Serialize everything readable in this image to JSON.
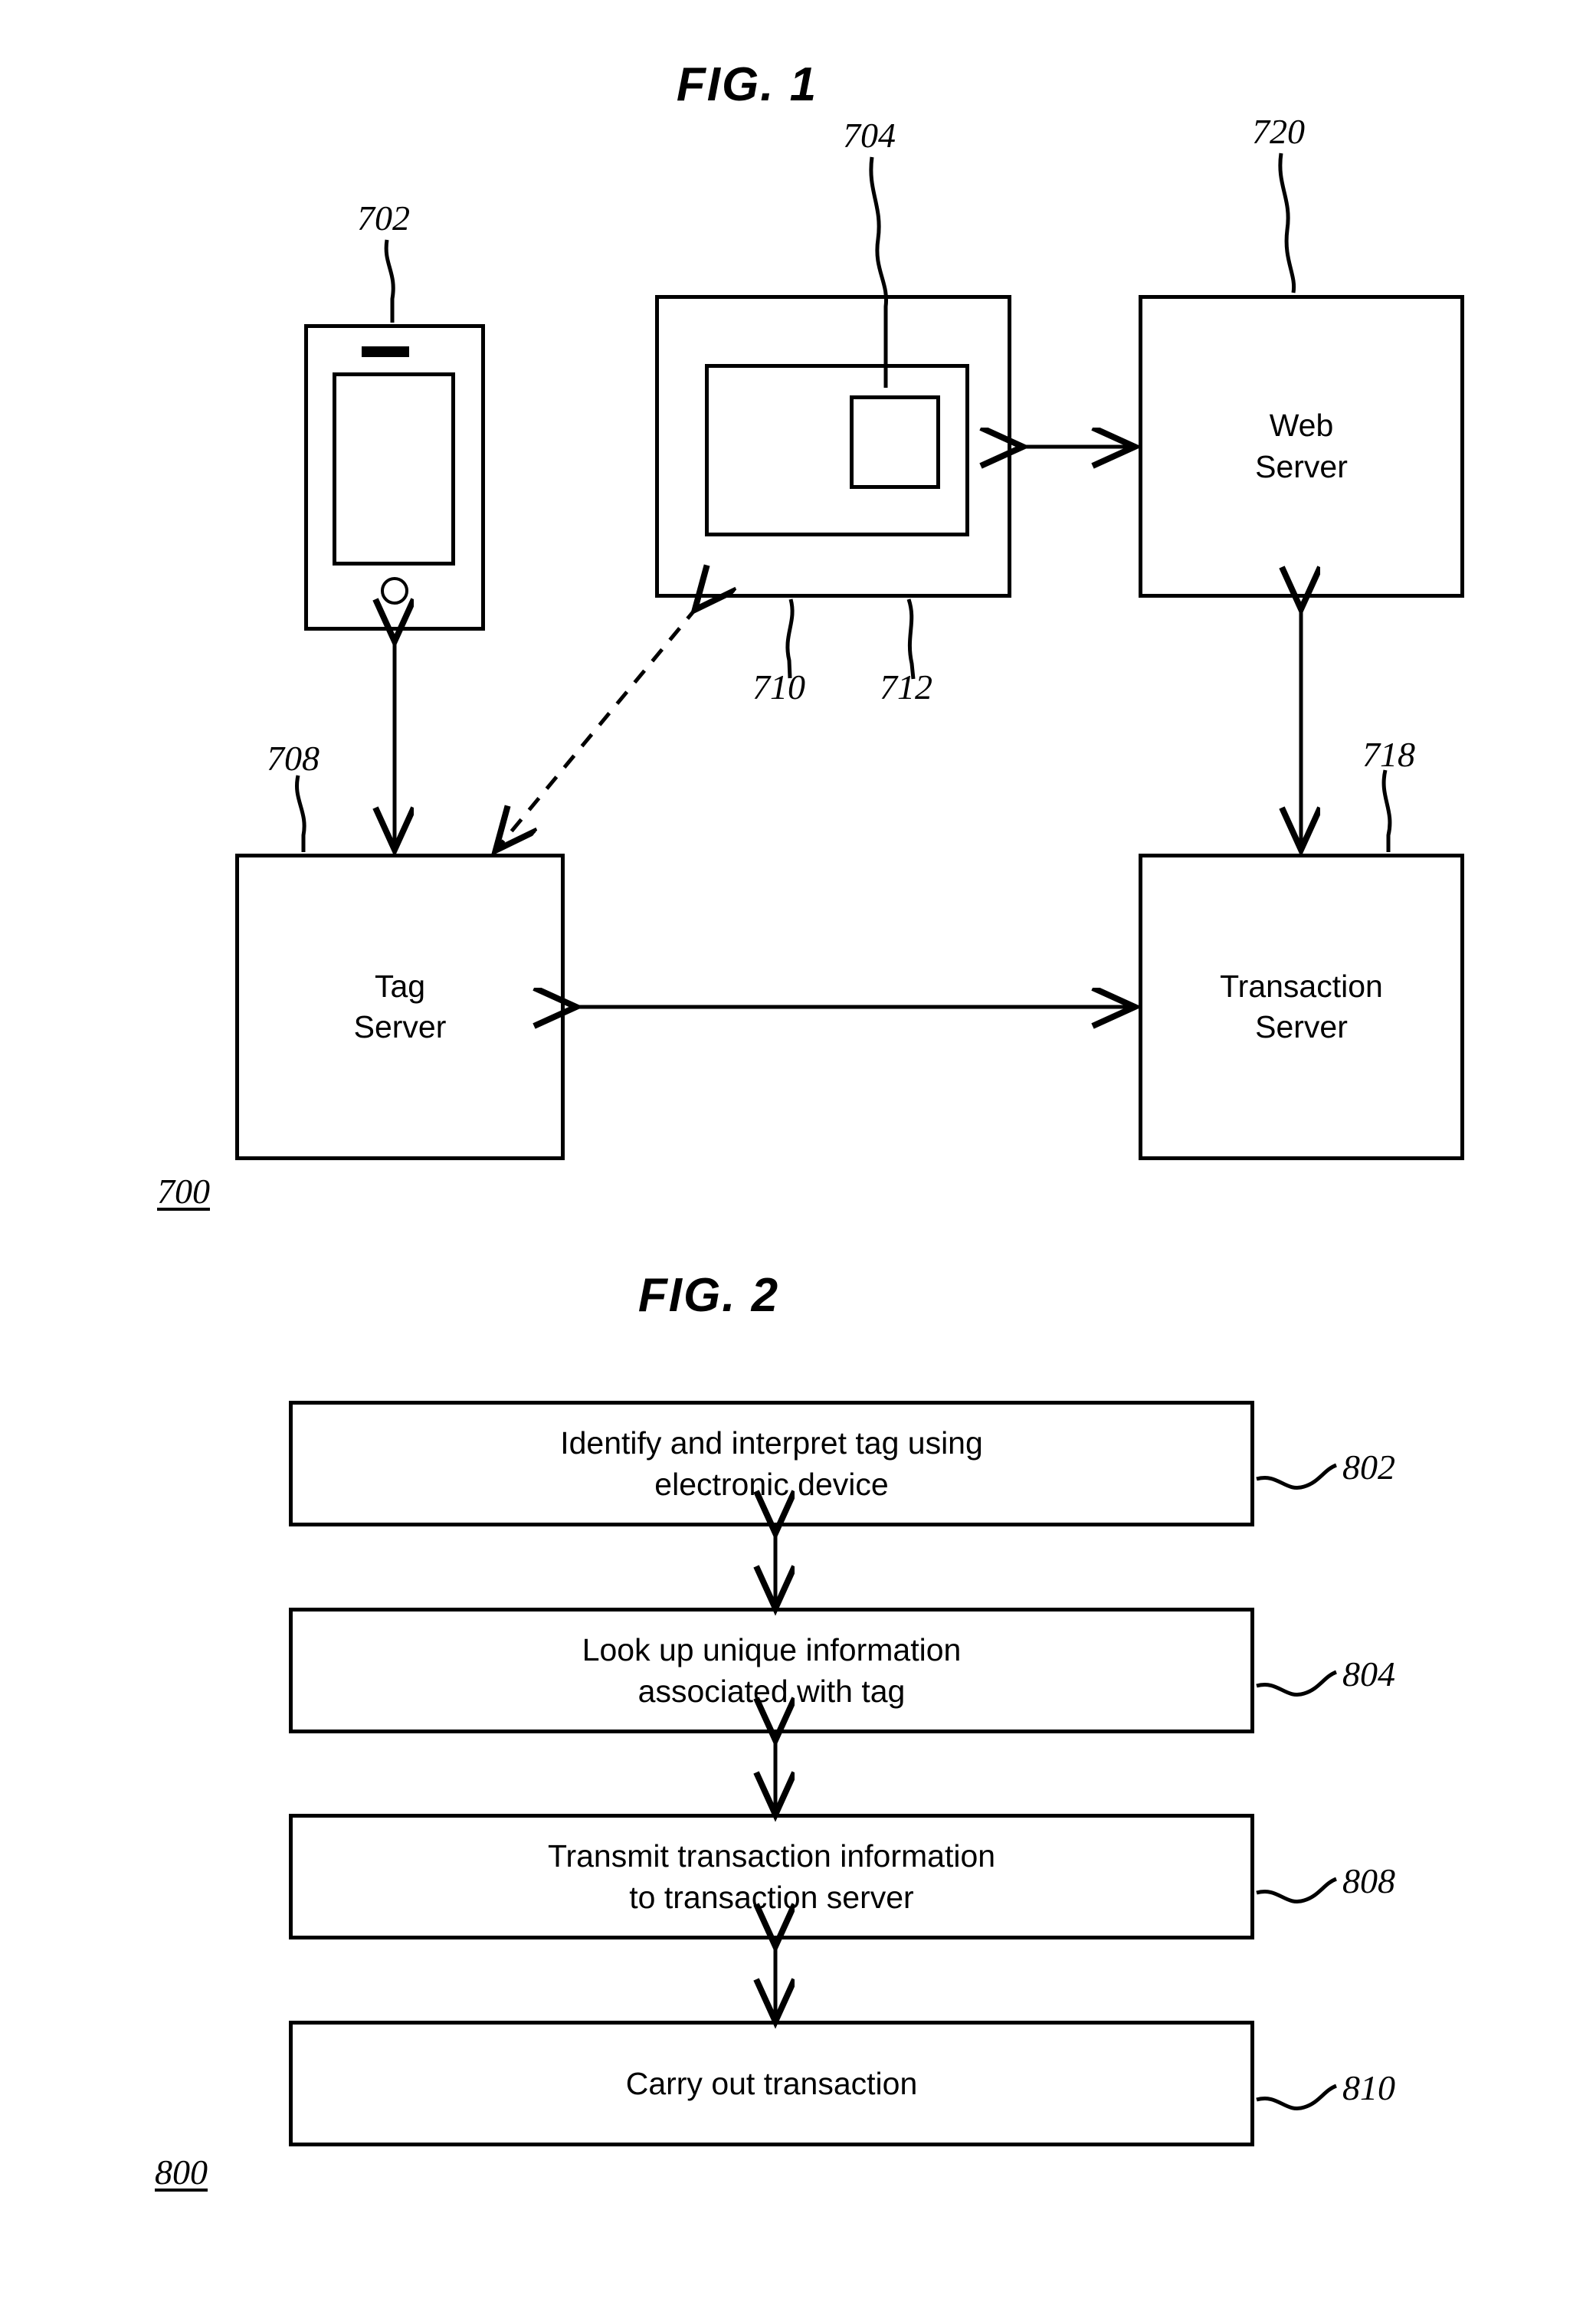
{
  "figures": [
    {
      "title": "FIG. 1",
      "diagram_ref": "700",
      "nodes": [
        {
          "ref": "702",
          "label": "",
          "kind": "mobile-device"
        },
        {
          "ref": "704",
          "label": "",
          "kind": "tag"
        },
        {
          "ref": "710",
          "label": "",
          "kind": "display-device"
        },
        {
          "ref": "712",
          "label": "",
          "kind": "display-screen"
        },
        {
          "ref": "720",
          "label": "Web\nServer",
          "kind": "server"
        },
        {
          "ref": "708",
          "label": "Tag\nServer",
          "kind": "server"
        },
        {
          "ref": "718",
          "label": "Transaction\nServer",
          "kind": "server"
        }
      ],
      "connections": [
        {
          "from": "710",
          "to": "720",
          "style": "solid",
          "arrows": "both"
        },
        {
          "from": "702",
          "to": "708",
          "style": "solid",
          "arrows": "both"
        },
        {
          "from": "710",
          "to": "708",
          "style": "dashed",
          "arrows": "both"
        },
        {
          "from": "720",
          "to": "718",
          "style": "solid",
          "arrows": "both"
        },
        {
          "from": "708",
          "to": "718",
          "style": "solid",
          "arrows": "both"
        }
      ]
    },
    {
      "title": "FIG. 2",
      "diagram_ref": "800",
      "steps": [
        {
          "ref": "802",
          "label": "Identify and interpret tag using\nelectronic device"
        },
        {
          "ref": "804",
          "label": "Look up unique information\nassociated with tag"
        },
        {
          "ref": "808",
          "label": "Transmit transaction information\nto transaction server"
        },
        {
          "ref": "810",
          "label": "Carry out transaction"
        }
      ],
      "connector_style": "double-headed-arrow"
    }
  ],
  "colors": {
    "ink": "#000000",
    "paper": "#ffffff"
  }
}
